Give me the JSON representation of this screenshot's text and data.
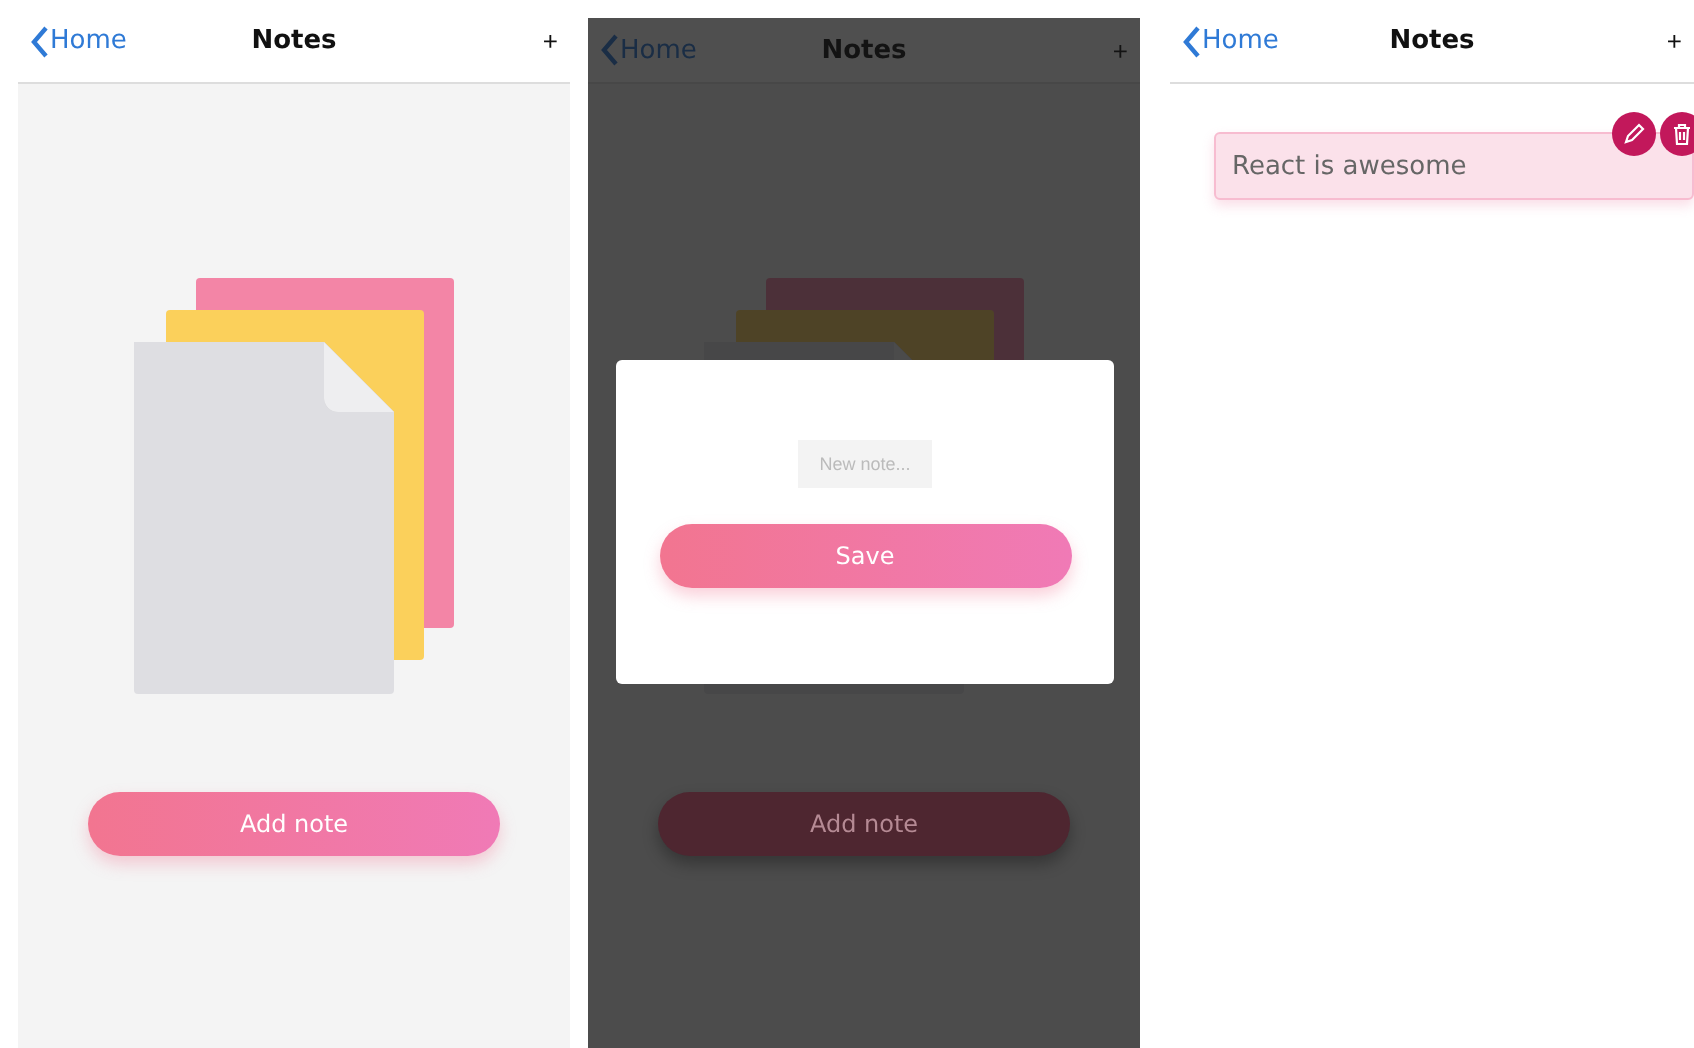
{
  "screens": [
    {
      "kind": "empty",
      "dimmed": false,
      "nav": {
        "back": "Home",
        "title": "Notes",
        "action": "+"
      },
      "add_button": "Add note"
    },
    {
      "kind": "empty",
      "dimmed": true,
      "nav": {
        "back": "Home",
        "title": "Notes",
        "action": "+"
      },
      "add_button": "Add note",
      "modal": {
        "placeholder": "New note...",
        "button": "Save"
      }
    },
    {
      "kind": "list",
      "dimmed": false,
      "nav": {
        "back": "Home",
        "title": "Notes",
        "action": "+"
      },
      "notes": [
        {
          "text": "React is awesome"
        }
      ]
    }
  ]
}
